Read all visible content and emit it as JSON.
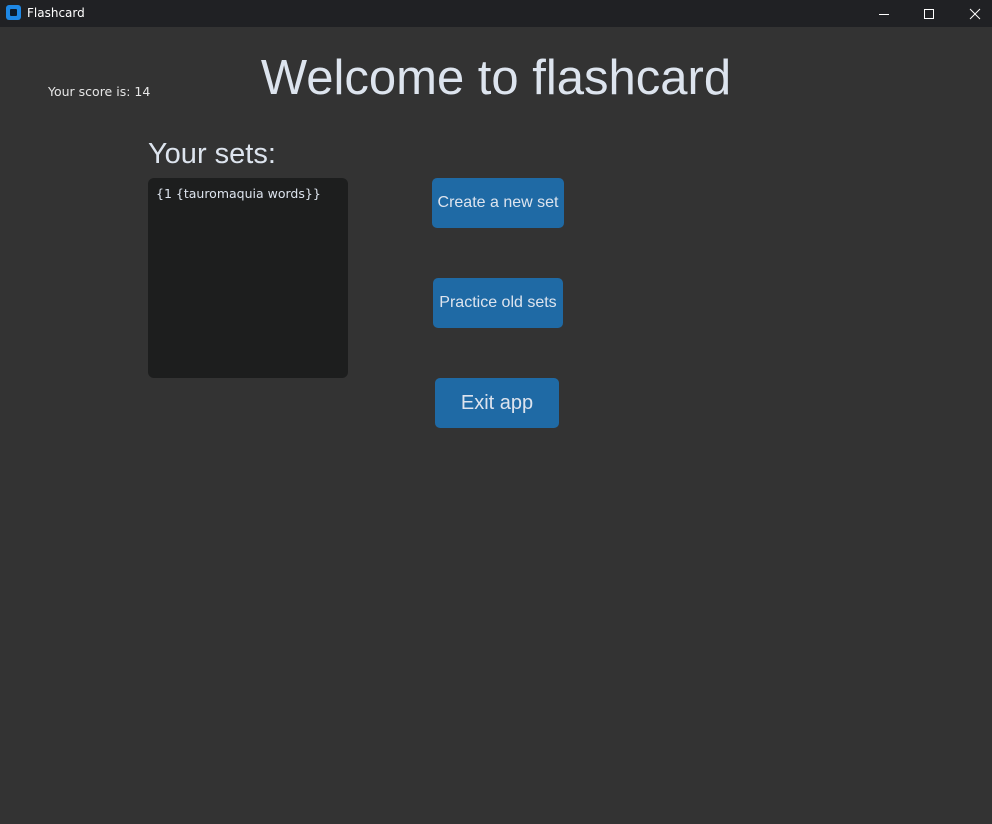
{
  "window": {
    "title": "Flashcard",
    "controls": [
      "minimize-icon",
      "maximize-icon",
      "close-icon"
    ]
  },
  "score": {
    "label": "Your score is: 14"
  },
  "heading": "Welcome to flashcard",
  "sets": {
    "label": "Your sets:",
    "content": "{1 {tauromaquia words}}"
  },
  "buttons": {
    "create": "Create a new set",
    "practice": "Practice old sets",
    "exit": "Exit app"
  },
  "colors": {
    "background": "#333333",
    "titlebar": "#202124",
    "button": "#1f6aa5",
    "textbox": "#1d1e1e",
    "text": "#dde4ee"
  }
}
